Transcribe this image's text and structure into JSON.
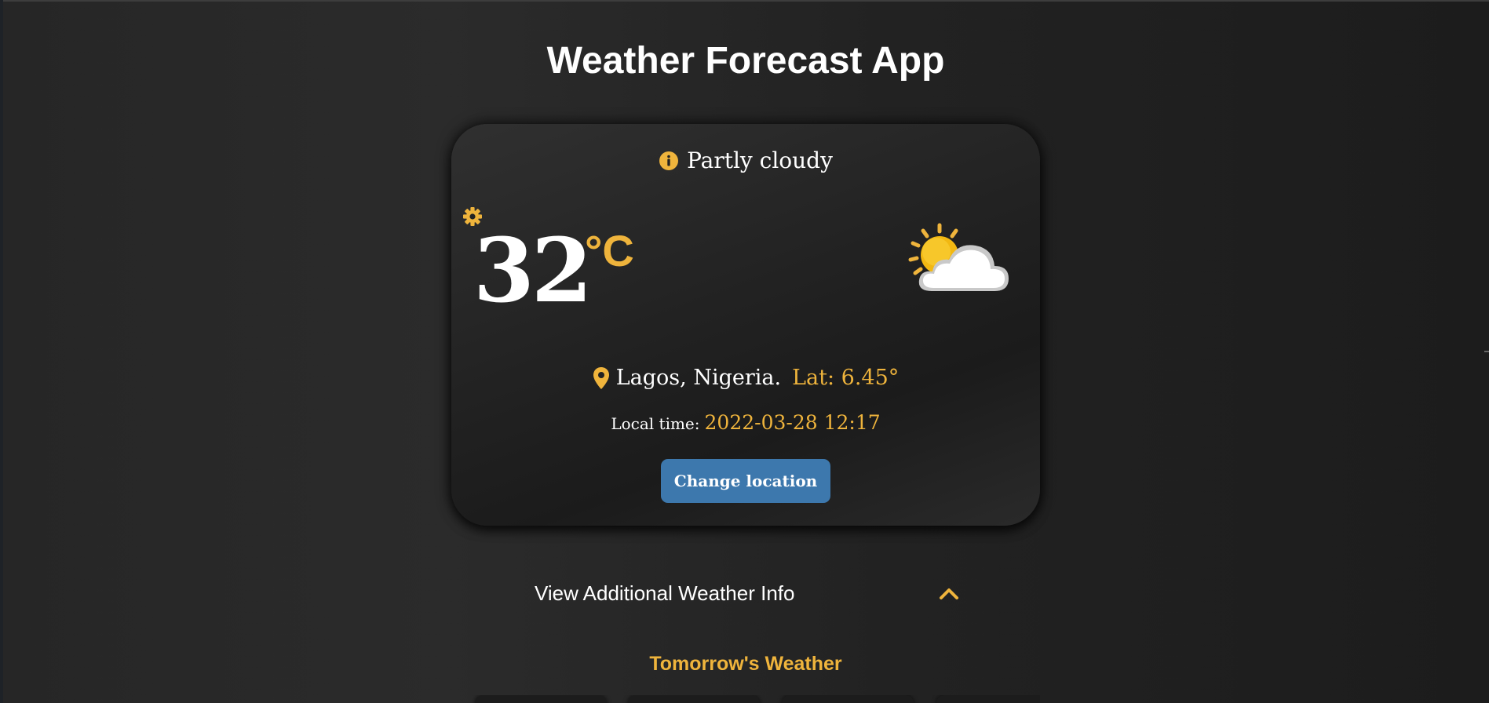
{
  "app": {
    "title": "Weather Forecast App"
  },
  "current": {
    "condition": "Partly cloudy",
    "temperature": "32",
    "unit": "°C",
    "location": "Lagos, Nigeria.",
    "latitude": "Lat: 6.45°",
    "local_time_label": "Local time:",
    "local_time": "2022-03-28 12:17",
    "change_location_label": "Change location",
    "weather_icon": "partly-cloudy-icon"
  },
  "additional": {
    "label": "View Additional Weather Info",
    "expanded": true
  },
  "tomorrow": {
    "title": "Tomorrow's Weather",
    "visible_cards": 4
  },
  "colors": {
    "accent": "#efb43c",
    "button": "#3d78ad",
    "background": "#262626",
    "card": "#222222",
    "text": "#ffffff"
  },
  "icons": [
    "info-icon",
    "gear-icon",
    "partly-cloudy-icon",
    "map-pin-icon",
    "chevron-up-icon"
  ]
}
